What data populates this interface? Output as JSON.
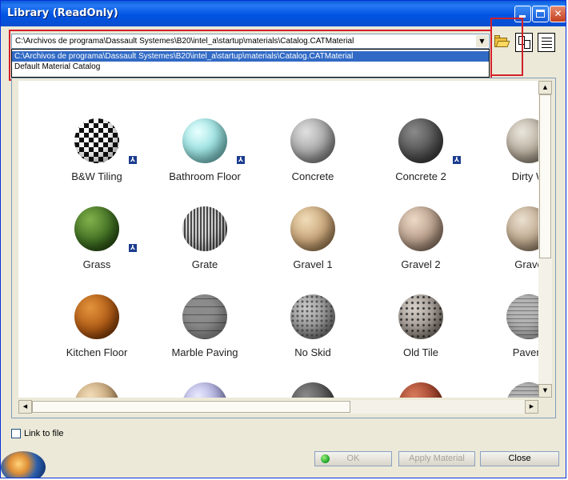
{
  "window": {
    "title": "Library (ReadOnly)"
  },
  "path_combo": {
    "value": "C:\\Archivos de programa\\Dassault Systemes\\B20\\intel_a\\startup\\materials\\Catalog.CATMaterial",
    "options": [
      "C:\\Archivos de programa\\Dassault Systemes\\B20\\intel_a\\startup\\materials\\Catalog.CATMaterial",
      "Default Material Catalog"
    ]
  },
  "materials": [
    {
      "label": "B&W Tiling",
      "texture": "checker",
      "linked": true
    },
    {
      "label": "Bathroom Floor",
      "texture": "aqua",
      "linked": true
    },
    {
      "label": "Concrete",
      "texture": "concrete",
      "linked": false
    },
    {
      "label": "Concrete 2",
      "texture": "darkconcrete",
      "linked": true
    },
    {
      "label": "Dirty W",
      "texture": "dirty",
      "linked": false
    },
    {
      "label": "Grass",
      "texture": "grass",
      "linked": true
    },
    {
      "label": "Grate",
      "texture": "grate",
      "linked": false
    },
    {
      "label": "Gravel 1",
      "texture": "gravel1",
      "linked": false
    },
    {
      "label": "Gravel 2",
      "texture": "gravel2",
      "linked": false
    },
    {
      "label": "Grave",
      "texture": "gravel3",
      "linked": false
    },
    {
      "label": "Kitchen Floor",
      "texture": "kitchen",
      "linked": false
    },
    {
      "label": "Marble Paving",
      "texture": "marble",
      "linked": false
    },
    {
      "label": "No Skid",
      "texture": "noskid",
      "linked": false
    },
    {
      "label": "Old Tile",
      "texture": "oldtile",
      "linked": false
    },
    {
      "label": "Pavem",
      "texture": "pavement",
      "linked": false
    },
    {
      "label": "",
      "texture": "gravel1",
      "linked": false
    },
    {
      "label": "",
      "texture": "lavender",
      "linked": false
    },
    {
      "label": "",
      "texture": "darkconcrete",
      "linked": false
    },
    {
      "label": "",
      "texture": "brick",
      "linked": false
    },
    {
      "label": "",
      "texture": "pavement",
      "linked": false
    }
  ],
  "link_to_file": {
    "label": "Link to file",
    "checked": false
  },
  "buttons": {
    "ok": "OK",
    "apply": "Apply Material",
    "close": "Close"
  },
  "colors": {
    "title_bar": "#0054e3",
    "selection": "#316ac5",
    "highlight_frame": "#d2212a"
  }
}
